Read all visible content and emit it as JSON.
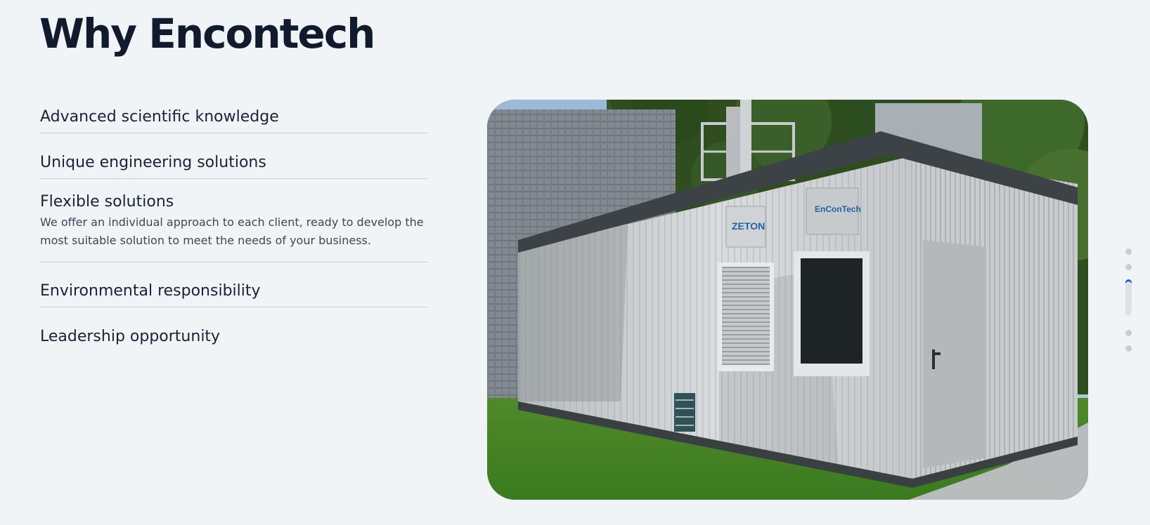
{
  "section": {
    "title": "Why Encontech"
  },
  "features": [
    {
      "title": "Advanced scientific knowledge"
    },
    {
      "title": "Unique engineering solutions"
    },
    {
      "title": "Flexible solutions",
      "description": "We offer an individual approach to each client, ready to develop the most suitable solution to meet the needs of your business."
    },
    {
      "title": "Environmental responsibility"
    },
    {
      "title": "Leadership opportunity"
    }
  ],
  "image": {
    "sign_zeton": "ZETON",
    "sign_encontech": "EnConTech"
  },
  "pagination": {
    "count": 5,
    "active_index": 2
  },
  "colors": {
    "background": "#f0f4f7",
    "heading": "#121a2e",
    "accent": "#1f5fd6",
    "divider": "#c5ccd3"
  }
}
